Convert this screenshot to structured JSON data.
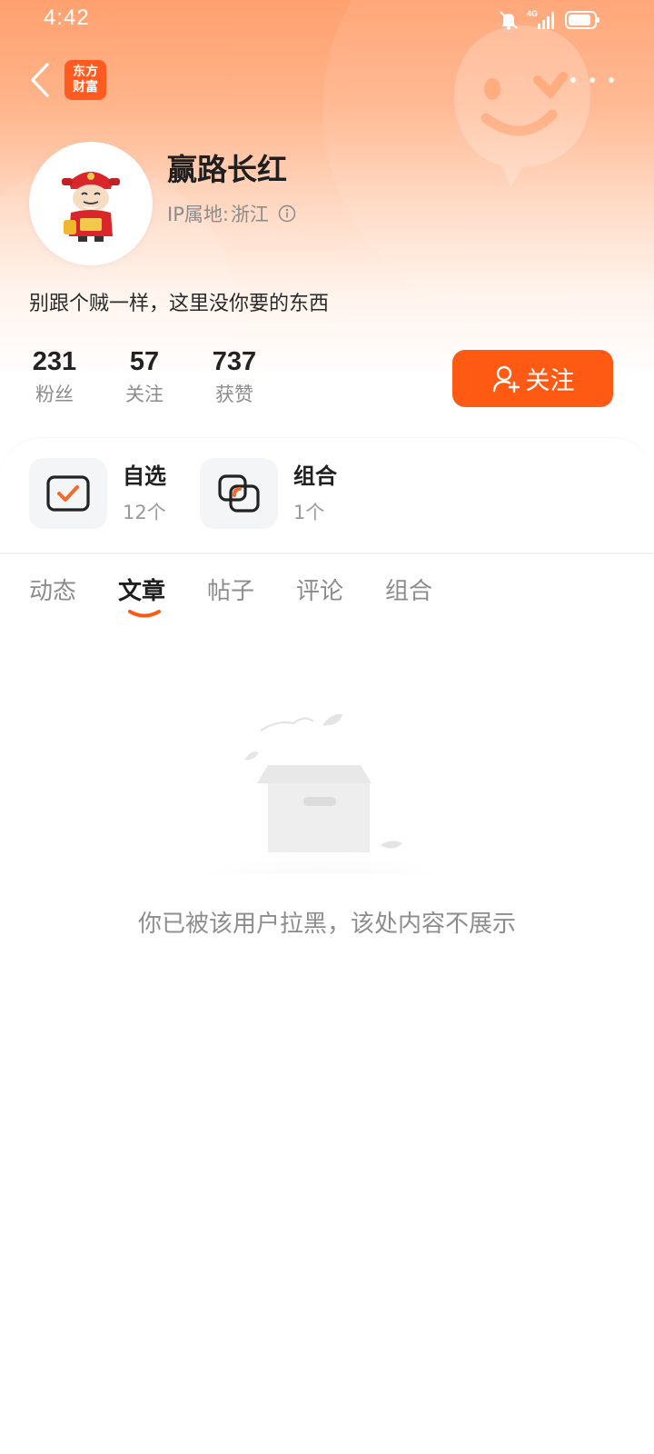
{
  "status_bar": {
    "time": "4:42",
    "network": "4G"
  },
  "nav": {
    "app_logo_line1": "东方",
    "app_logo_line2": "财富"
  },
  "profile": {
    "name": "赢路长红",
    "ip_label": "IP属地:",
    "ip_location": "浙江",
    "bio": "别跟个贼一样，这里没你要的东西"
  },
  "stats": [
    {
      "value": "231",
      "label": "粉丝"
    },
    {
      "value": "57",
      "label": "关注"
    },
    {
      "value": "737",
      "label": "获赞"
    }
  ],
  "follow_button": {
    "label": "关注"
  },
  "shortcuts": [
    {
      "title": "自选",
      "count": "12个"
    },
    {
      "title": "组合",
      "count": "1个"
    }
  ],
  "tabs": [
    {
      "label": "动态",
      "active": false
    },
    {
      "label": "文章",
      "active": true
    },
    {
      "label": "帖子",
      "active": false
    },
    {
      "label": "评论",
      "active": false
    },
    {
      "label": "组合",
      "active": false
    }
  ],
  "empty_state": {
    "message": "你已被该用户拉黑，该处内容不展示"
  },
  "colors": {
    "accent": "#ff5a14",
    "logo_bg": "#ff5a1f",
    "header_top": "#ffa06f"
  }
}
